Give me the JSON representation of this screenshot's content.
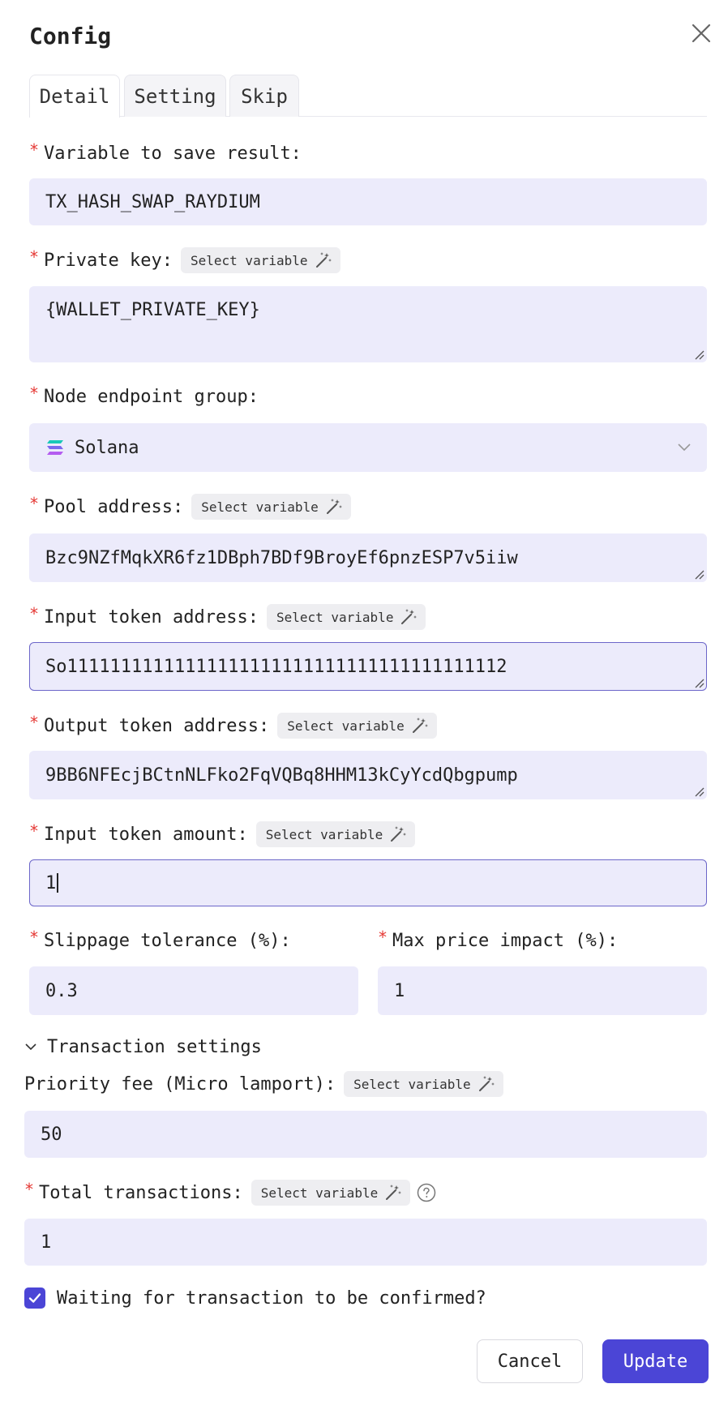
{
  "dialog": {
    "title": "Config"
  },
  "tabs": [
    {
      "label": "Detail",
      "active": true
    },
    {
      "label": "Setting",
      "active": false
    },
    {
      "label": "Skip",
      "active": false
    }
  ],
  "common": {
    "select_variable": "Select variable",
    "required_mark": "*"
  },
  "fields": {
    "result_var": {
      "label": "Variable to save result:",
      "value": "TX_HASH_SWAP_RAYDIUM"
    },
    "private_key": {
      "label": "Private key:",
      "value": "{WALLET_PRIVATE_KEY}"
    },
    "node_group": {
      "label": "Node endpoint group:",
      "value": "Solana"
    },
    "pool_address": {
      "label": "Pool address:",
      "value": "Bzc9NZfMqkXR6fz1DBph7BDf9BroyEf6pnzESP7v5iiw"
    },
    "input_token": {
      "label": "Input token address:",
      "value": "So11111111111111111111111111111111111111112"
    },
    "output_token": {
      "label": "Output token address:",
      "value": "9BB6NFEcjBCtnNLFko2FqVQBq8HHM13kCyYcdQbgpump"
    },
    "input_amount": {
      "label": "Input token amount:",
      "value": "1"
    },
    "slippage": {
      "label": "Slippage tolerance (%):",
      "value": "0.3"
    },
    "max_impact": {
      "label": "Max price impact (%):",
      "value": "1"
    }
  },
  "transaction_settings": {
    "label": "Transaction settings",
    "priority_fee": {
      "label": "Priority fee (Micro lamport):",
      "value": "50"
    },
    "total_tx": {
      "label": "Total transactions:",
      "value": "1"
    },
    "wait_confirm": {
      "label": "Waiting for transaction to be confirmed?",
      "checked": true
    }
  },
  "footer": {
    "cancel": "Cancel",
    "update": "Update"
  },
  "colors": {
    "accent": "#4b45d6",
    "field_bg": "#ecebfb",
    "required": "#e53935"
  }
}
